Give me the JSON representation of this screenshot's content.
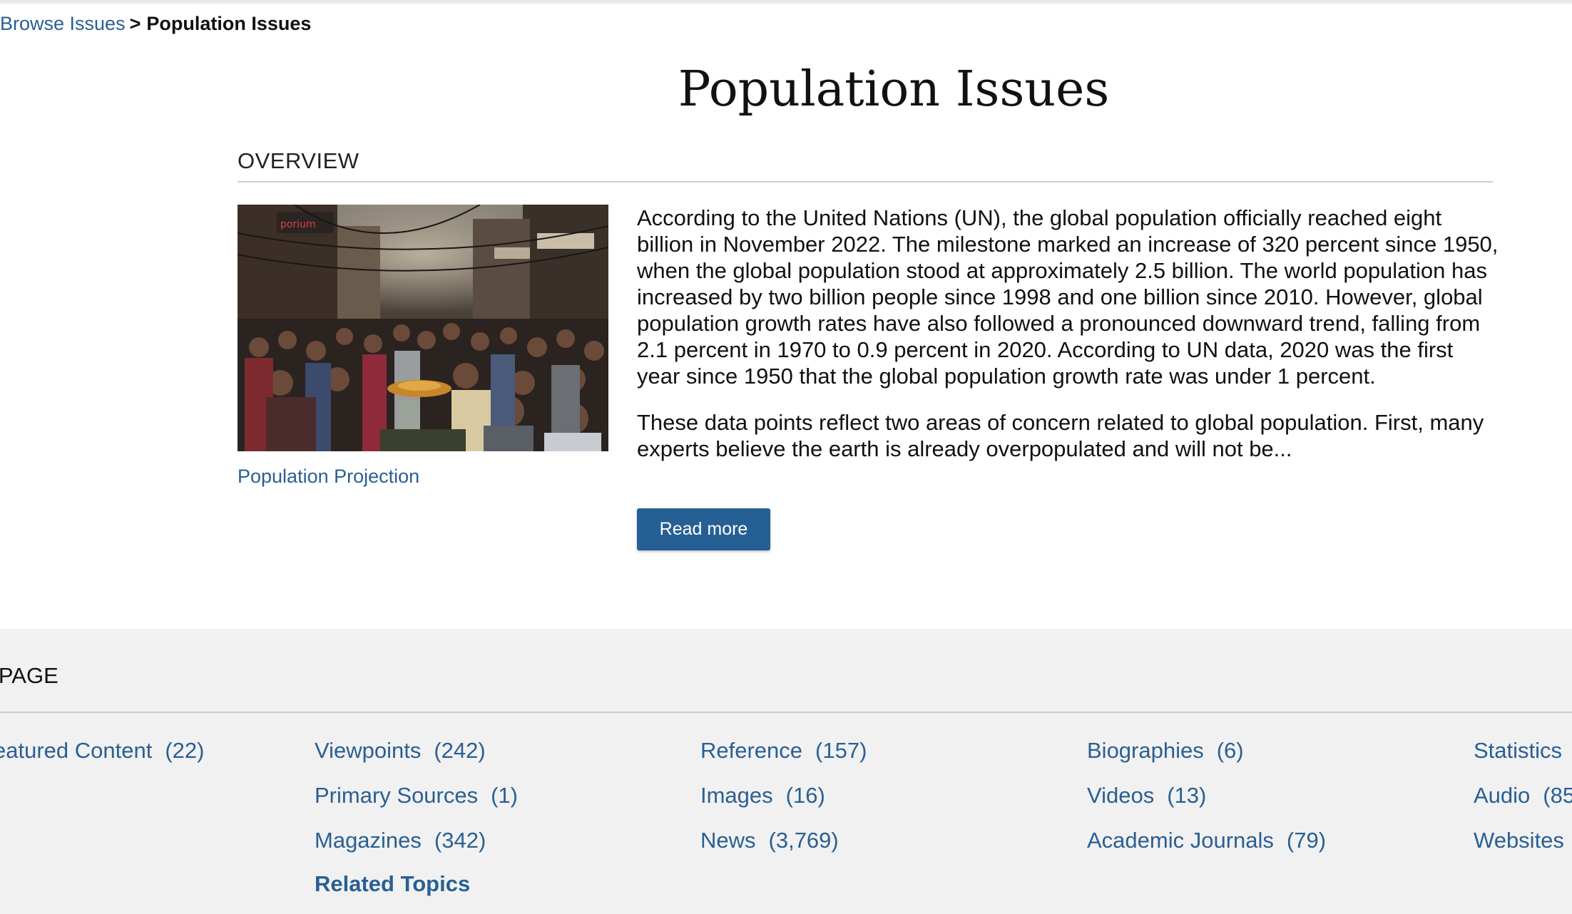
{
  "breadcrumb": {
    "parent": "Browse Issues",
    "separator": ">",
    "current": "Population Issues"
  },
  "page_title": "Population Issues",
  "overview": {
    "heading": "OVERVIEW",
    "image_caption": "Population Projection",
    "paragraphs": [
      "According to the United Nations (UN), the global population officially reached eight billion in November 2022. The milestone marked an increase of 320 percent since 1950, when the global population stood at approximately 2.5 billion. The world population has increased by two billion people since 1998 and one billion since 2010. However, global population growth rates have also followed a pronounced downward trend, falling from 2.1 percent in 1970 to 0.9 percent in 2020. According to UN data, 2020 was the first year since 1950 that the global population growth rate was under 1 percent.",
      "These data points reflect two areas of concern related to global population. First, many experts believe the earth is already overpopulated and will not be..."
    ],
    "read_more_label": "Read more"
  },
  "on_this_page": {
    "heading": "IS PAGE",
    "links": [
      {
        "label": "eatured Content",
        "count": "(22)"
      },
      {
        "label": "Viewpoints",
        "count": "(242)"
      },
      {
        "label": "Primary Sources",
        "count": "(1)"
      },
      {
        "label": "Magazines",
        "count": "(342)"
      },
      {
        "label": "Reference",
        "count": "(157)"
      },
      {
        "label": "Images",
        "count": "(16)"
      },
      {
        "label": "News",
        "count": "(3,769)"
      },
      {
        "label": "Biographies",
        "count": "(6)"
      },
      {
        "label": "Videos",
        "count": "(13)"
      },
      {
        "label": "Academic Journals",
        "count": "(79)"
      },
      {
        "label": "Statistics",
        "count": ""
      },
      {
        "label": "Audio",
        "count": "(85"
      },
      {
        "label": "Websites",
        "count": ""
      }
    ],
    "related_topics_label": "Related Topics"
  },
  "colors": {
    "link": "#2a5f93",
    "button": "#265f93",
    "gray_section": "#f1f1f1"
  }
}
